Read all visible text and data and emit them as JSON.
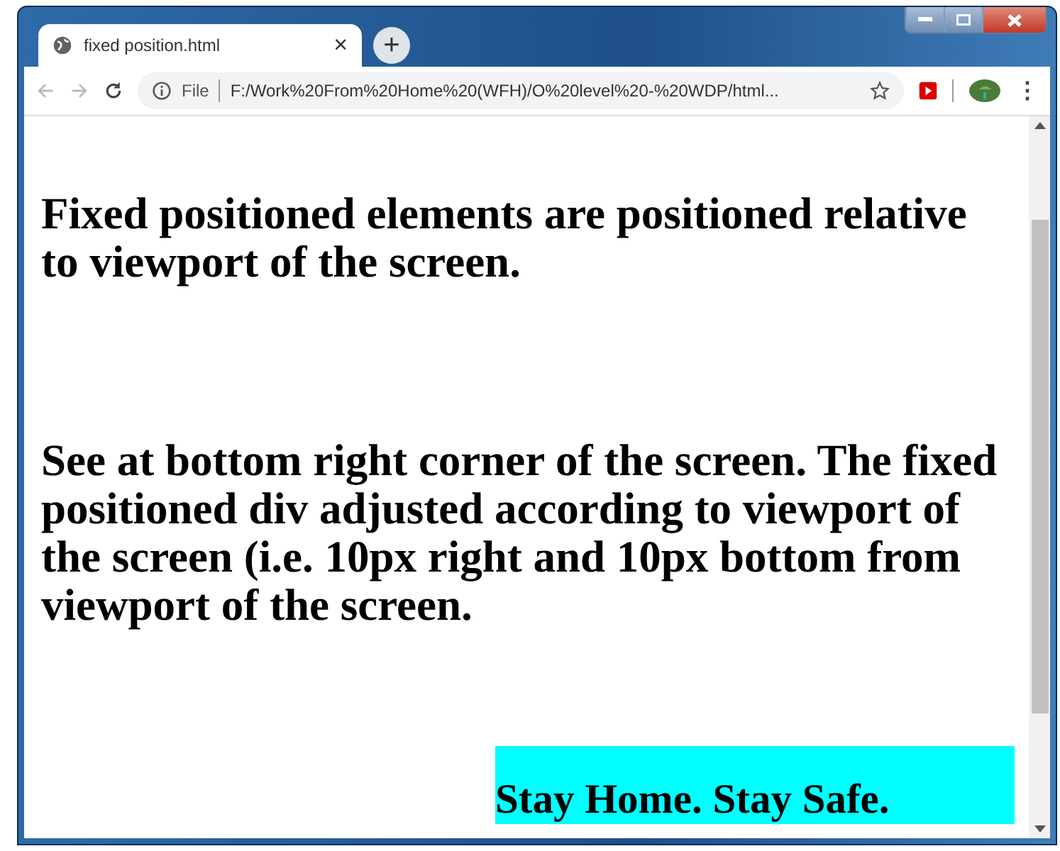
{
  "tab": {
    "title": "fixed position.html",
    "close": "×",
    "selected": true
  },
  "new_tab": "+",
  "address_bar": {
    "scheme": "File",
    "url": "F:/Work%20From%20Home%20(WFH)/O%20level%20-%20WDP/html..."
  },
  "menu": "⋮",
  "page": {
    "paragraphs": [
      "Fixed positioned elements are positioned relative to viewport of the screen.",
      "See at bottom right corner of the screen. The fixed positioned div adjusted according to viewport of the screen (i.e. 10px right and 10px bottom from viewport of the screen."
    ],
    "fixed_box": "Stay Home. Stay Safe."
  }
}
